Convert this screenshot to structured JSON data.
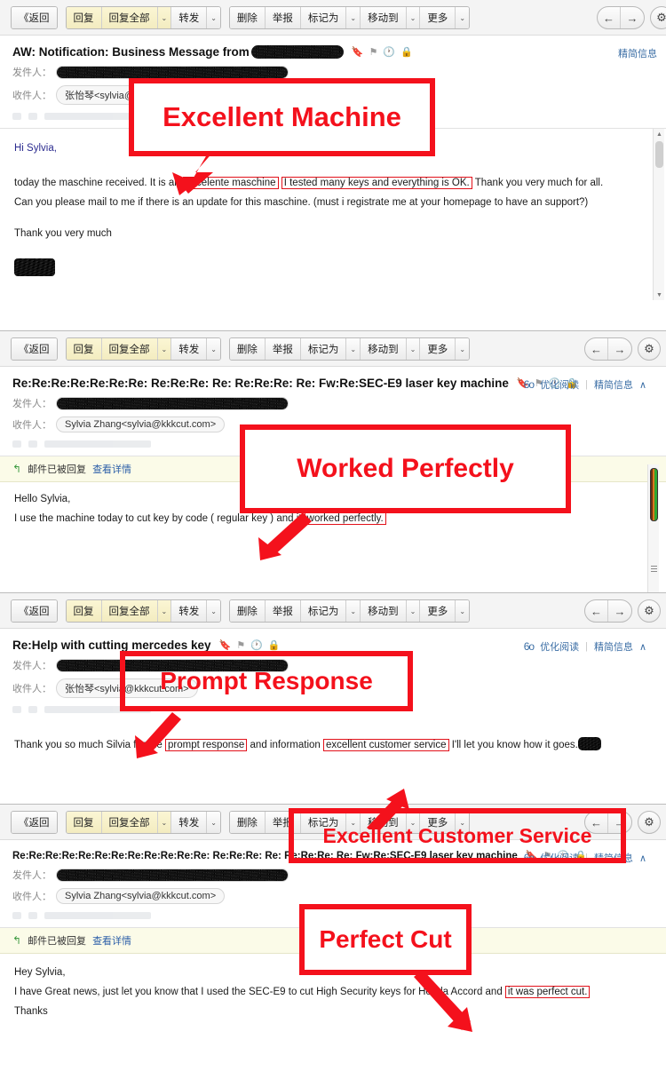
{
  "toolbar": {
    "back": "《返回",
    "reply": "回复",
    "reply_all": "回复全部",
    "forward": "转发",
    "delete": "删除",
    "report": "举报",
    "mark_as": "标记为",
    "move_to": "移动到",
    "more": "更多",
    "caret": "⌄",
    "nav_prev": "←",
    "nav_next": "→",
    "settings": "⚙"
  },
  "labels": {
    "from": "发件人：",
    "to": "收件人：",
    "optimized_reading": "优化阅读",
    "simplified_info": "精简信息",
    "simplified_info_caret": "∧",
    "glasses_icon": "6ᴏ",
    "separator": "|",
    "replied_notice": "邮件已被回复",
    "view_details": "查看详情",
    "reply_arrow": "↰"
  },
  "subject_icons": [
    "🔖",
    "⚑",
    "🕐",
    "🔒"
  ],
  "colors": {
    "annotation_red": "#f4111c",
    "toolbar_bg": "#f4f4f4",
    "reply_button_yellow": "#fbf6d4",
    "notice_bg": "#fbfbe8",
    "link_blue": "#2c5fa8"
  },
  "panels": [
    {
      "id": "panel-1",
      "subject": "AW: Notification: Business Message from",
      "subject_redacted": true,
      "to_value": "张怡琴<sylvia@kkkcut.com>",
      "head_right": [
        "精简信息"
      ],
      "has_notice": false,
      "body": [
        {
          "text": "Hi Sylvia,",
          "style": "blue"
        },
        {
          "text": "",
          "style": "spacer"
        },
        {
          "style": "mixed",
          "parts": [
            {
              "t": "today the maschine received. It is an ",
              "hl": false
            },
            {
              "t": "excelente maschine",
              "hl": true
            },
            {
              "t": " ",
              "hl": false
            },
            {
              "t": "I tested many keys and everything is OK.",
              "hl": true
            },
            {
              "t": " Thank you very much for all.",
              "hl": false
            }
          ]
        },
        {
          "text": "Can you please mail to me if there is an update for this maschine. (must i registrate me at your homepage to have an support?)",
          "style": "plain"
        },
        {
          "text": "Thank you very much",
          "style": "gap"
        }
      ]
    },
    {
      "id": "panel-2",
      "subject": "Re:Re:Re:Re:Re:Re:Re: Re:Re:Re: Re: Re:Re:Re: Re: Fw:Re:SEC-E9 laser key machine",
      "subject_redacted": false,
      "to_value": "Sylvia Zhang<sylvia@kkkcut.com>",
      "head_right": [
        "优化阅读",
        "精简信息"
      ],
      "has_notice": true,
      "body": [
        {
          "text": "Hello Sylvia,",
          "style": "plain"
        },
        {
          "style": "mixed",
          "parts": [
            {
              "t": "I use the machine today to cut key by code ( regular key ) and it ",
              "hl": false
            },
            {
              "t": "worked perfectly.",
              "hl": true
            }
          ]
        }
      ]
    },
    {
      "id": "panel-3",
      "subject": "Re:Help with cutting mercedes key",
      "subject_redacted": false,
      "to_value": "张怡琴<sylvia@kkkcut.com>",
      "head_right": [
        "优化阅读",
        "精简信息"
      ],
      "has_notice": false,
      "body": [
        {
          "style": "mixed",
          "parts": [
            {
              "t": "Thank you so much Silvia for the ",
              "hl": false
            },
            {
              "t": "prompt response",
              "hl": true
            },
            {
              "t": " and information ",
              "hl": false
            },
            {
              "t": "excellent customer service",
              "hl": true
            },
            {
              "t": " I'll let you know how it goes.",
              "hl": false
            }
          ]
        }
      ]
    },
    {
      "id": "panel-4",
      "subject": "Re:Re:Re:Re:Re:Re:Re:Re:Re:Re:Re:Re: Re:Re:Re: Re: Re:Re:Re: Re: Fw:Re:SEC-E9 laser key machine",
      "subject_redacted": false,
      "to_value": "Sylvia Zhang<sylvia@kkkcut.com>",
      "head_right": [
        "优化阅读",
        "精简信息"
      ],
      "has_notice": true,
      "body": [
        {
          "text": "Hey Sylvia,",
          "style": "plain"
        },
        {
          "style": "mixed",
          "parts": [
            {
              "t": "I have Great news, just let you know that I used the SEC-E9 to cut High Security keys for Honda Accord and ",
              "hl": false
            },
            {
              "t": "it was perfect cut.",
              "hl": true
            }
          ]
        },
        {
          "text": "Thanks",
          "style": "plain"
        }
      ]
    }
  ],
  "annotations": [
    {
      "id": "anno-1",
      "label": "Excellent Machine"
    },
    {
      "id": "anno-2",
      "label": "Worked Perfectly"
    },
    {
      "id": "anno-3",
      "label": "Prompt Response"
    },
    {
      "id": "anno-4",
      "label": "Excellent Customer Service"
    },
    {
      "id": "anno-5",
      "label": "Perfect Cut"
    }
  ]
}
